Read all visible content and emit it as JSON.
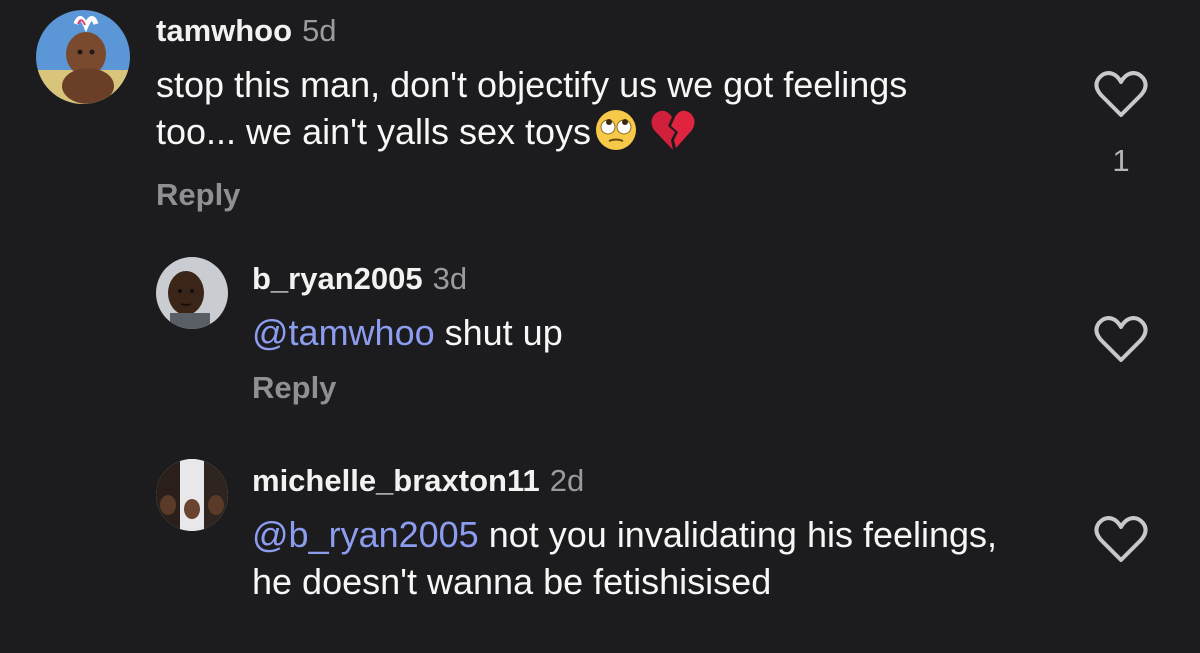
{
  "comments": [
    {
      "username": "tamwhoo",
      "time": "5d",
      "text": "stop this man, don't objectify us we got feelings too... we ain't yalls sex toys",
      "emojis": [
        "face-with-rolling-eyes-emoji",
        "broken-heart-emoji"
      ],
      "reply_label": "Reply",
      "like_count": "1"
    },
    {
      "username": "b_ryan2005",
      "time": "3d",
      "mention": "@tamwhoo",
      "text": " shut up",
      "reply_label": "Reply"
    },
    {
      "username": "michelle_braxton11",
      "time": "2d",
      "mention": "@b_ryan2005",
      "text": " not you invalidating his feelings, he doesn't wanna be fetishisised"
    }
  ],
  "colors": {
    "background": "#1c1c1e",
    "mention": "#8c9df0",
    "muted": "#9a9a9f"
  }
}
